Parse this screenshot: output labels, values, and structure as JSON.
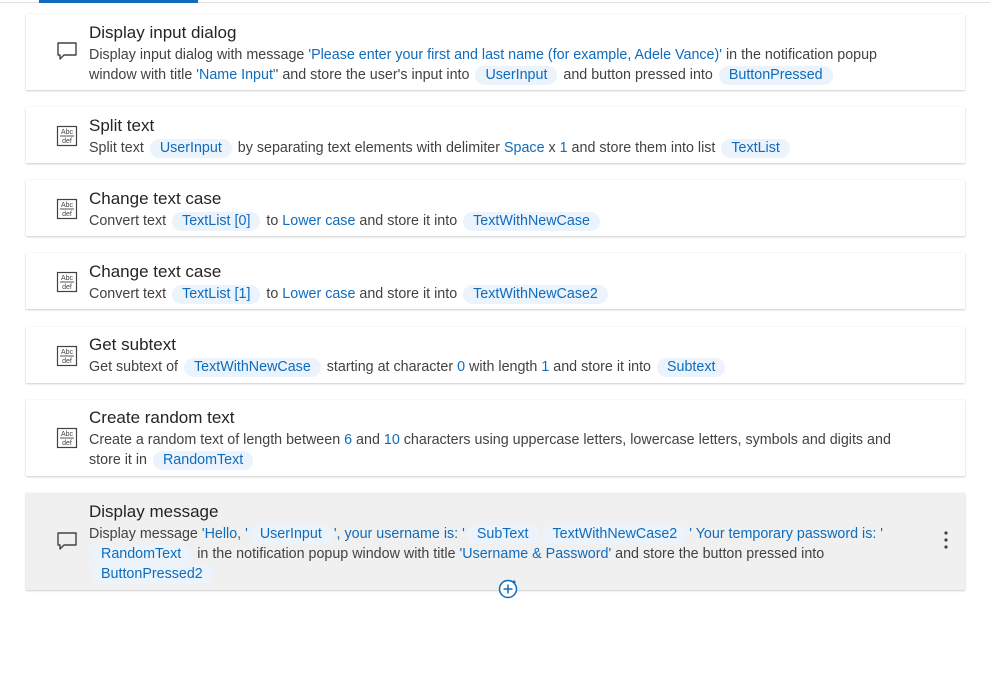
{
  "steps": [
    {
      "title": "Display input dialog",
      "icon": "message-box-icon",
      "d": [
        "Display input dialog with message ",
        "'Please enter your first and last name (for example, Adele Vance)'",
        " in the notification popup window with title ",
        "'Name Input'",
        "' and store the user's input into ",
        "UserInput",
        " and button pressed into ",
        "ButtonPressed"
      ]
    },
    {
      "title": "Split text",
      "icon": "text-abc-icon",
      "d": [
        "Split text ",
        "UserInput",
        " by separating text elements with delimiter ",
        "Space",
        " x ",
        "1",
        " and store them into list ",
        "TextList"
      ]
    },
    {
      "title": "Change text case",
      "icon": "text-abc-icon",
      "d": [
        "Convert text ",
        "TextList",
        "[0]",
        " to ",
        "Lower case",
        " and store it into ",
        "TextWithNewCase"
      ]
    },
    {
      "title": "Change text case",
      "icon": "text-abc-icon",
      "d": [
        "Convert text ",
        "TextList",
        "[1]",
        " to ",
        "Lower case",
        " and store it into ",
        "TextWithNewCase2"
      ]
    },
    {
      "title": "Get subtext",
      "icon": "text-abc-icon",
      "d": [
        "Get subtext of ",
        "TextWithNewCase",
        " starting at character ",
        "0",
        " with length ",
        "1",
        " and store it into ",
        "Subtext"
      ]
    },
    {
      "title": "Create random text",
      "icon": "text-abc-icon",
      "d": [
        "Create a random text of length between ",
        "6",
        " and ",
        "10",
        " characters using uppercase letters, lowercase letters, symbols and digits and store it in ",
        "RandomText"
      ]
    },
    {
      "title": "Display message",
      "icon": "message-box-icon",
      "d": [
        "Display message ",
        "'Hello, '",
        "UserInput",
        "', your username is: '",
        "SubText",
        "TextWithNewCase2",
        "' Your temporary password is: '",
        "RandomText",
        " in the notification popup window with title ",
        "'Username & Password'",
        " and store the button pressed into ",
        "ButtonPressed2"
      ]
    }
  ],
  "icons": {
    "abc_top": "Abc",
    "abc_bottom": "def",
    "more": "more-vertical-icon",
    "add": "add-step-icon"
  },
  "colors": {
    "accent": "#0f6cbd",
    "variable_pill_bg": "#ebf3fc",
    "selected_bg": "#f0f0f0"
  }
}
